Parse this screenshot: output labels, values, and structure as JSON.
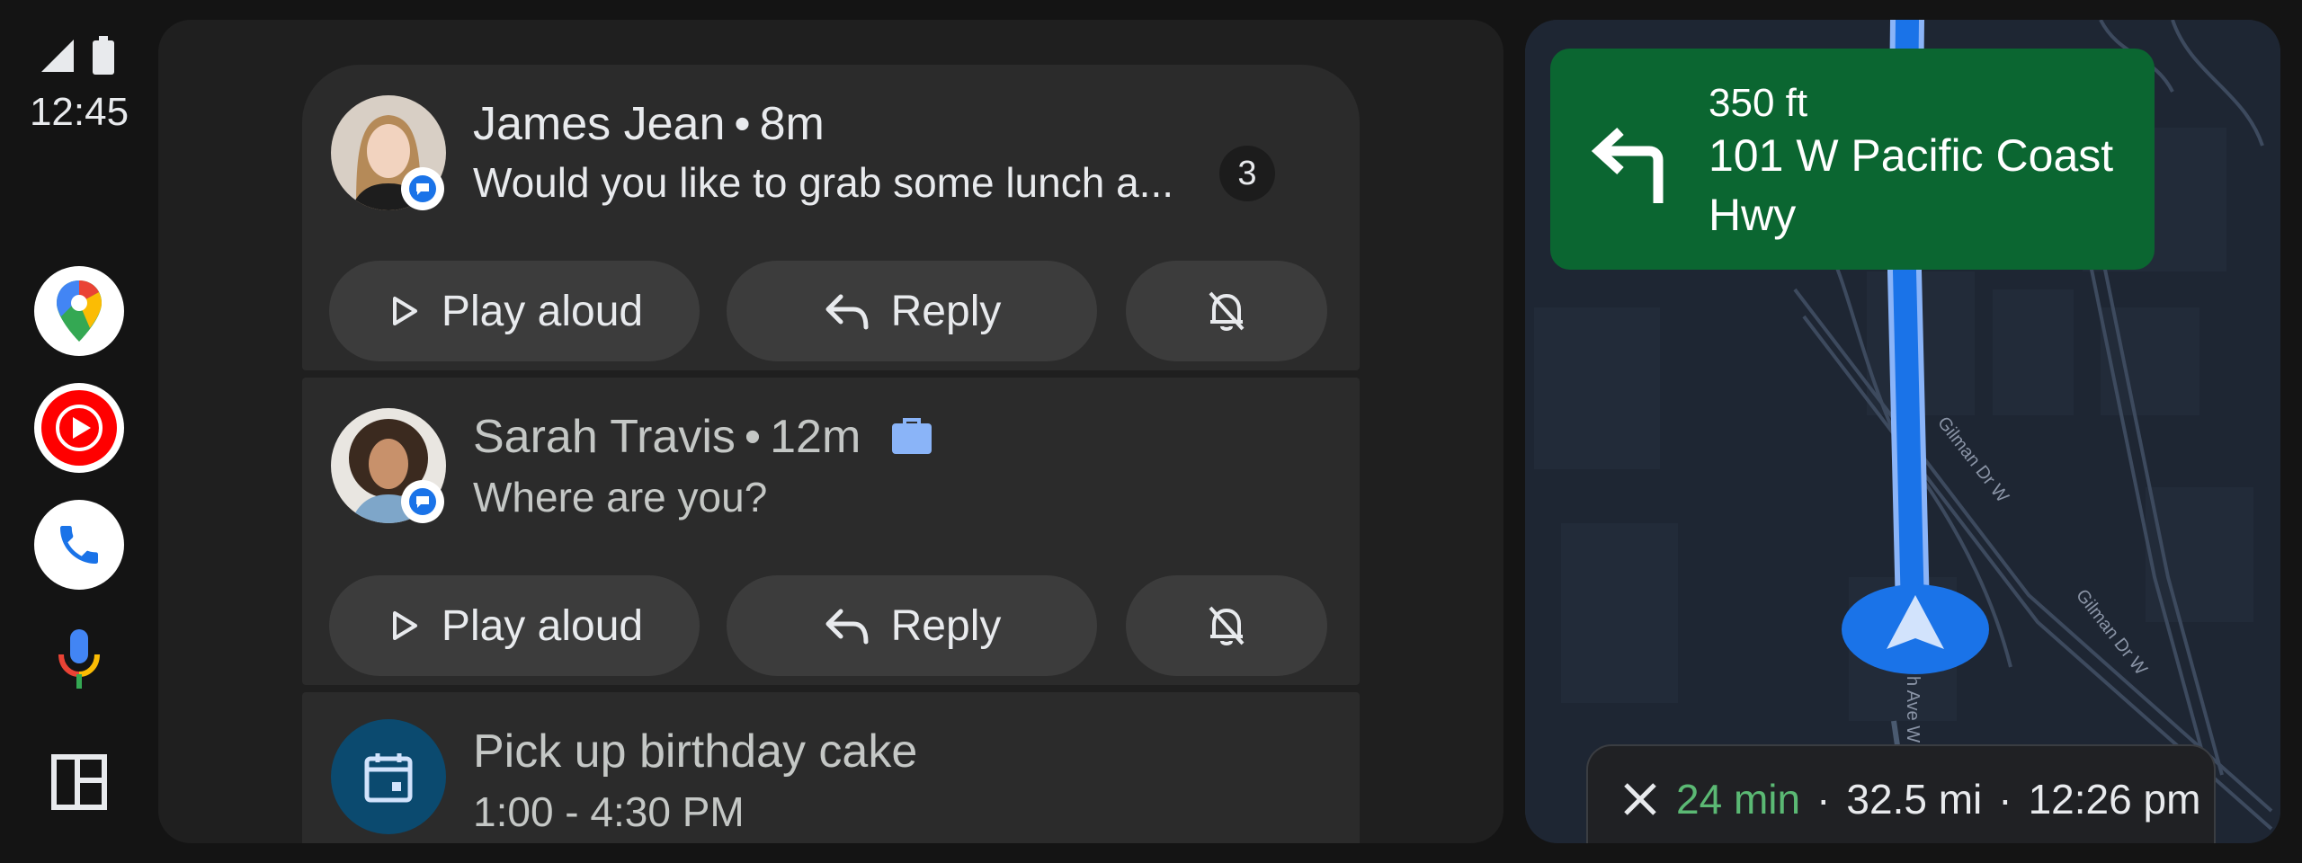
{
  "status": {
    "time": "12:45",
    "signal_icon": "signal-icon",
    "battery_icon": "battery-icon"
  },
  "rail": {
    "apps": [
      {
        "name": "maps",
        "icon": "google-maps-icon"
      },
      {
        "name": "youtube-music",
        "icon": "youtube-music-icon"
      },
      {
        "name": "phone",
        "icon": "phone-icon"
      }
    ],
    "assistant_icon": "microphone-icon",
    "dashboard_icon": "dashboard-icon"
  },
  "notifications": [
    {
      "sender": "James Jean",
      "age": "8m",
      "separator": "•",
      "message": "Would you like to grab some lunch a...",
      "count": "3",
      "actions": {
        "play": "Play aloud",
        "reply": "Reply"
      }
    },
    {
      "sender": "Sarah Travis",
      "age": "12m",
      "separator": "•",
      "message": "Where are you?",
      "actions": {
        "play": "Play aloud",
        "reply": "Reply"
      }
    },
    {
      "title": "Pick up birthday cake",
      "time": "1:00 - 4:30 PM"
    }
  ],
  "navigation": {
    "distance": "350 ft",
    "street": "101 W Pacific Coast Hwy",
    "eta_minutes": "24 min",
    "eta_distance": "32.5 mi",
    "eta_arrival": "12:26 pm",
    "separator": "·",
    "map_labels": [
      "Gilman Dr W",
      "Gilman Dr W",
      "h Ave W"
    ]
  },
  "colors": {
    "nav_green": "#0b6631",
    "eta_green": "#5bb974",
    "route_blue": "#1a73e8",
    "work_badge": "#8ab4f8"
  }
}
